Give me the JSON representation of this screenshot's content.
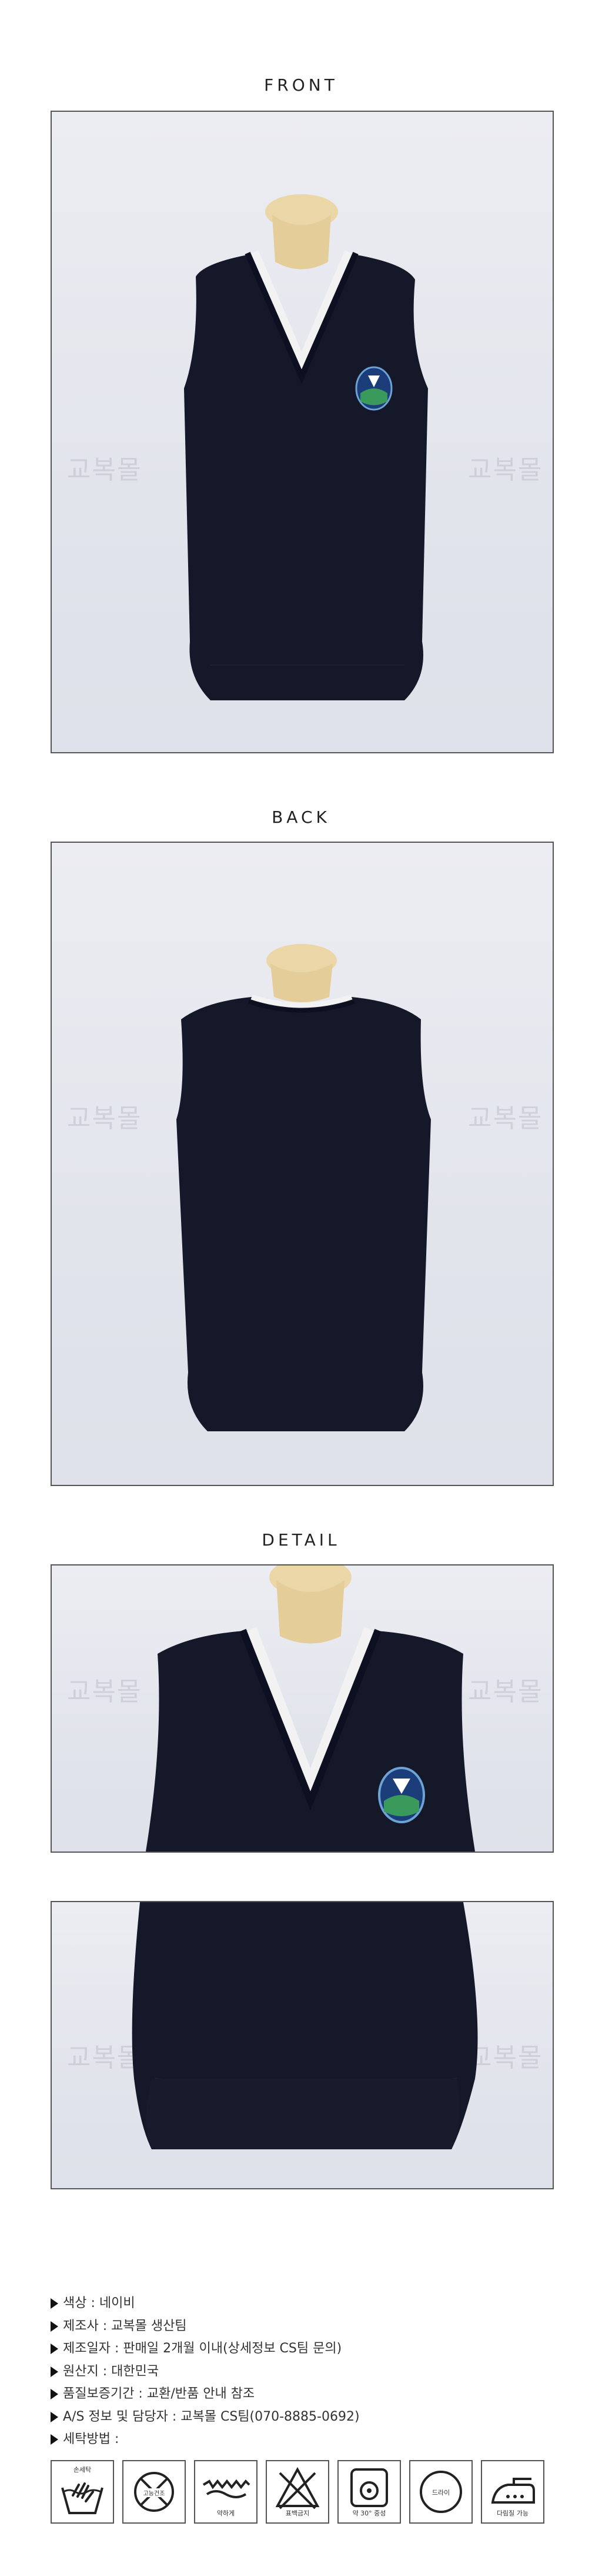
{
  "sections": {
    "front": "FRONT",
    "back": "BACK",
    "detail": "DETAIL"
  },
  "watermark": "교복몰",
  "colors": {
    "vest": "#141828",
    "trim": "#f2f2f2",
    "background": "#e6e8ef",
    "mannequin": "#e6cf9c"
  },
  "info": [
    "색상 : 네이비",
    "제조사 : 교복몰 생산팀",
    "제조일자 : 판매일 2개월 이내(상세정보 CS팀 문의)",
    "원산지 : 대한민국",
    "품질보증기간 : 교환/반품 안내 참조",
    "A/S 정보 및 담당자 : 교복몰 CS팀(070-8885-0692)",
    "세탁방법 :"
  ],
  "care": [
    {
      "icon": "hand-wash-icon",
      "label": "손세탁",
      "label_pos": "top"
    },
    {
      "icon": "no-tumble-dry-icon",
      "label": "고능건조",
      "label_pos": "inner"
    },
    {
      "icon": "wring-gently-icon",
      "label": "약하게",
      "label_pos": "bottom"
    },
    {
      "icon": "no-bleach-icon",
      "label": "표백금지",
      "label_pos": "bottom"
    },
    {
      "icon": "machine-wash-icon",
      "label": "약 30° 중성",
      "label_pos": "bottom"
    },
    {
      "icon": "dry-clean-icon",
      "label": "드라이",
      "label_pos": "inner"
    },
    {
      "icon": "iron-icon",
      "label": "다림질 가능",
      "label_pos": "bottom"
    }
  ]
}
